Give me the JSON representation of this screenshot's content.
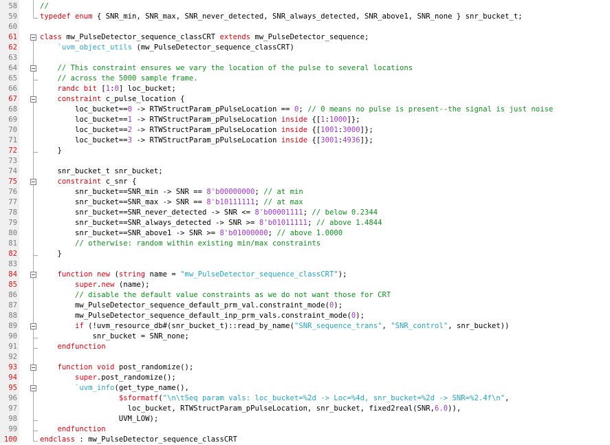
{
  "colors": {
    "keyword": "#e0000f",
    "comment": "#10901e",
    "string": "#24a4c4",
    "macro": "#2ea3cf",
    "number": "#9f34d2",
    "linenum": "#7a7a7a",
    "linenum_changed": "#d61818"
  },
  "lines": [
    {
      "n": "58",
      "changed": false,
      "segs": [
        {
          "t": "//",
          "c": "cm"
        }
      ]
    },
    {
      "n": "59",
      "changed": false,
      "segs": [
        {
          "t": "typedef enum",
          "c": "kw"
        },
        {
          "t": " { SNR_min, SNR_max, SNR_never_detected, SNR_always_detected, SNR_above1, SNR_none } snr_bucket_t;"
        }
      ]
    },
    {
      "n": "60",
      "changed": false,
      "segs": []
    },
    {
      "n": "61",
      "changed": true,
      "segs": [
        {
          "t": "class",
          "c": "kw"
        },
        {
          "t": " mw_PulseDetector_sequence_classCRT "
        },
        {
          "t": "extends",
          "c": "kw"
        },
        {
          "t": " mw_PulseDetector_sequence;"
        }
      ]
    },
    {
      "n": "62",
      "changed": true,
      "segs": [
        {
          "t": "    "
        },
        {
          "t": "`uvm_object_utils",
          "c": "mac"
        },
        {
          "t": " (mw_PulseDetector_sequence_classCRT)"
        }
      ]
    },
    {
      "n": "63",
      "changed": false,
      "segs": []
    },
    {
      "n": "64",
      "changed": false,
      "segs": [
        {
          "t": "    "
        },
        {
          "t": "// This constraint ensures we vary the location of the pulse to several locations",
          "c": "cm"
        }
      ]
    },
    {
      "n": "65",
      "changed": false,
      "segs": [
        {
          "t": "    "
        },
        {
          "t": "// across the 5000 sample frame.",
          "c": "cm"
        }
      ]
    },
    {
      "n": "66",
      "changed": false,
      "segs": [
        {
          "t": "    "
        },
        {
          "t": "randc bit",
          "c": "kw"
        },
        {
          "t": " ["
        },
        {
          "t": "1",
          "c": "nm"
        },
        {
          "t": ":"
        },
        {
          "t": "0",
          "c": "nm"
        },
        {
          "t": "] loc_bucket;"
        }
      ]
    },
    {
      "n": "67",
      "changed": true,
      "segs": [
        {
          "t": "    "
        },
        {
          "t": "constraint",
          "c": "kw"
        },
        {
          "t": " c_pulse_location {"
        }
      ]
    },
    {
      "n": "68",
      "changed": false,
      "segs": [
        {
          "t": "        loc_bucket=="
        },
        {
          "t": "0",
          "c": "nm"
        },
        {
          "t": " -> RTWStructParam_pPulseLocation == "
        },
        {
          "t": "0",
          "c": "nm"
        },
        {
          "t": "; "
        },
        {
          "t": "// 0 means no pulse is present--the signal is just noise",
          "c": "cm"
        }
      ]
    },
    {
      "n": "69",
      "changed": false,
      "segs": [
        {
          "t": "        loc_bucket=="
        },
        {
          "t": "1",
          "c": "nm"
        },
        {
          "t": " -> RTWStructParam_pPulseLocation "
        },
        {
          "t": "inside",
          "c": "kw"
        },
        {
          "t": " {["
        },
        {
          "t": "1",
          "c": "nm"
        },
        {
          "t": ":"
        },
        {
          "t": "1000",
          "c": "nm"
        },
        {
          "t": "]};"
        }
      ]
    },
    {
      "n": "70",
      "changed": false,
      "segs": [
        {
          "t": "        loc_bucket=="
        },
        {
          "t": "2",
          "c": "nm"
        },
        {
          "t": " -> RTWStructParam_pPulseLocation "
        },
        {
          "t": "inside",
          "c": "kw"
        },
        {
          "t": " {["
        },
        {
          "t": "1001",
          "c": "nm"
        },
        {
          "t": ":"
        },
        {
          "t": "3000",
          "c": "nm"
        },
        {
          "t": "]};"
        }
      ]
    },
    {
      "n": "71",
      "changed": false,
      "segs": [
        {
          "t": "        loc_bucket=="
        },
        {
          "t": "3",
          "c": "nm"
        },
        {
          "t": " -> RTWStructParam_pPulseLocation "
        },
        {
          "t": "inside",
          "c": "kw"
        },
        {
          "t": " {["
        },
        {
          "t": "3001",
          "c": "nm"
        },
        {
          "t": ":"
        },
        {
          "t": "4936",
          "c": "nm"
        },
        {
          "t": "]};"
        }
      ]
    },
    {
      "n": "72",
      "changed": true,
      "segs": [
        {
          "t": "    }"
        }
      ]
    },
    {
      "n": "73",
      "changed": false,
      "segs": []
    },
    {
      "n": "74",
      "changed": false,
      "segs": [
        {
          "t": "    snr_bucket_t snr_bucket;"
        }
      ]
    },
    {
      "n": "75",
      "changed": true,
      "segs": [
        {
          "t": "    "
        },
        {
          "t": "constraint",
          "c": "kw"
        },
        {
          "t": " c_snr {"
        }
      ]
    },
    {
      "n": "76",
      "changed": false,
      "segs": [
        {
          "t": "        snr_bucket==SNR_min -> SNR == "
        },
        {
          "t": "8'b00000000",
          "c": "nm"
        },
        {
          "t": "; "
        },
        {
          "t": "// at min",
          "c": "cm"
        }
      ]
    },
    {
      "n": "77",
      "changed": false,
      "segs": [
        {
          "t": "        snr_bucket==SNR_max -> SNR == "
        },
        {
          "t": "8'b10111111",
          "c": "nm"
        },
        {
          "t": "; "
        },
        {
          "t": "// at max",
          "c": "cm"
        }
      ]
    },
    {
      "n": "78",
      "changed": false,
      "segs": [
        {
          "t": "        snr_bucket==SNR_never_detected -> SNR <= "
        },
        {
          "t": "8'b00001111",
          "c": "nm"
        },
        {
          "t": "; "
        },
        {
          "t": "// below 0.2344",
          "c": "cm"
        }
      ]
    },
    {
      "n": "79",
      "changed": false,
      "segs": [
        {
          "t": "        snr_bucket==SNR_always_detected -> SNR >= "
        },
        {
          "t": "8'b01011111",
          "c": "nm"
        },
        {
          "t": "; "
        },
        {
          "t": "// above 1.4844",
          "c": "cm"
        }
      ]
    },
    {
      "n": "80",
      "changed": false,
      "segs": [
        {
          "t": "        snr_bucket==SNR_above1 -> SNR >= "
        },
        {
          "t": "8'b01000000",
          "c": "nm"
        },
        {
          "t": "; "
        },
        {
          "t": "// above 1.0000",
          "c": "cm"
        }
      ]
    },
    {
      "n": "81",
      "changed": false,
      "segs": [
        {
          "t": "        "
        },
        {
          "t": "// otherwise: random within existing min/max constraints",
          "c": "cm"
        }
      ]
    },
    {
      "n": "82",
      "changed": true,
      "segs": [
        {
          "t": "    }"
        }
      ]
    },
    {
      "n": "83",
      "changed": false,
      "segs": []
    },
    {
      "n": "84",
      "changed": true,
      "segs": [
        {
          "t": "    "
        },
        {
          "t": "function new",
          "c": "kw"
        },
        {
          "t": " ("
        },
        {
          "t": "string",
          "c": "kw"
        },
        {
          "t": " name = "
        },
        {
          "t": "\"mw_PulseDetector_sequence_classCRT\"",
          "c": "st"
        },
        {
          "t": ");"
        }
      ]
    },
    {
      "n": "85",
      "changed": true,
      "segs": [
        {
          "t": "        "
        },
        {
          "t": "super",
          "c": "kw"
        },
        {
          "t": "."
        },
        {
          "t": "new",
          "c": "kw"
        },
        {
          "t": " (name);"
        }
      ]
    },
    {
      "n": "86",
      "changed": false,
      "segs": [
        {
          "t": "        "
        },
        {
          "t": "// disable the default value constraints as we do not want those for CRT",
          "c": "cm"
        }
      ]
    },
    {
      "n": "87",
      "changed": false,
      "segs": [
        {
          "t": "        mw_PulseDetector_sequence_default_prm_val.constraint_mode("
        },
        {
          "t": "0",
          "c": "nm"
        },
        {
          "t": ");"
        }
      ]
    },
    {
      "n": "88",
      "changed": false,
      "segs": [
        {
          "t": "        mw_PulseDetector_sequence_default_inp_prm_vals.constraint_mode("
        },
        {
          "t": "0",
          "c": "nm"
        },
        {
          "t": ");"
        }
      ]
    },
    {
      "n": "89",
      "changed": false,
      "segs": [
        {
          "t": "        "
        },
        {
          "t": "if",
          "c": "kw"
        },
        {
          "t": " (!uvm_resource_db#(snr_bucket_t)::read_by_name("
        },
        {
          "t": "\"SNR_sequence_trans\"",
          "c": "st"
        },
        {
          "t": ", "
        },
        {
          "t": "\"SNR_control\"",
          "c": "st"
        },
        {
          "t": ", snr_bucket))"
        }
      ]
    },
    {
      "n": "90",
      "changed": false,
      "segs": [
        {
          "t": "            snr_bucket = SNR_none;"
        }
      ]
    },
    {
      "n": "91",
      "changed": false,
      "segs": [
        {
          "t": "    "
        },
        {
          "t": "endfunction",
          "c": "kw"
        }
      ]
    },
    {
      "n": "92",
      "changed": false,
      "segs": []
    },
    {
      "n": "93",
      "changed": true,
      "segs": [
        {
          "t": "    "
        },
        {
          "t": "function void",
          "c": "kw"
        },
        {
          "t": " post_randomize();"
        }
      ]
    },
    {
      "n": "94",
      "changed": true,
      "segs": [
        {
          "t": "        "
        },
        {
          "t": "super",
          "c": "kw"
        },
        {
          "t": ".post_randomize();"
        }
      ]
    },
    {
      "n": "95",
      "changed": true,
      "segs": [
        {
          "t": "        "
        },
        {
          "t": "`uvm_info",
          "c": "mac"
        },
        {
          "t": "(get_type_name(),"
        }
      ]
    },
    {
      "n": "96",
      "changed": false,
      "segs": [
        {
          "t": "                  "
        },
        {
          "t": "$sformatf",
          "c": "kw"
        },
        {
          "t": "("
        },
        {
          "t": "\"\\n\\tSeq param vals: loc_bucket=%2d -> Loc=%4d, snr_bucket=%2d -> SNR=%2.4f\\n\"",
          "c": "st"
        },
        {
          "t": ","
        }
      ]
    },
    {
      "n": "97",
      "changed": false,
      "segs": [
        {
          "t": "                    loc_bucket, RTWStructParam_pPulseLocation, snr_bucket, fixed2real(SNR,"
        },
        {
          "t": "6.0",
          "c": "nm"
        },
        {
          "t": ")),"
        }
      ]
    },
    {
      "n": "98",
      "changed": false,
      "segs": [
        {
          "t": "                  UVM_LOW);"
        }
      ]
    },
    {
      "n": "99",
      "changed": false,
      "segs": [
        {
          "t": "    "
        },
        {
          "t": "endfunction",
          "c": "kw"
        }
      ]
    },
    {
      "n": "100",
      "changed": true,
      "segs": [
        {
          "t": "endclass",
          "c": "kw"
        },
        {
          "t": " : mw_PulseDetector_sequence_classCRT"
        }
      ]
    }
  ]
}
